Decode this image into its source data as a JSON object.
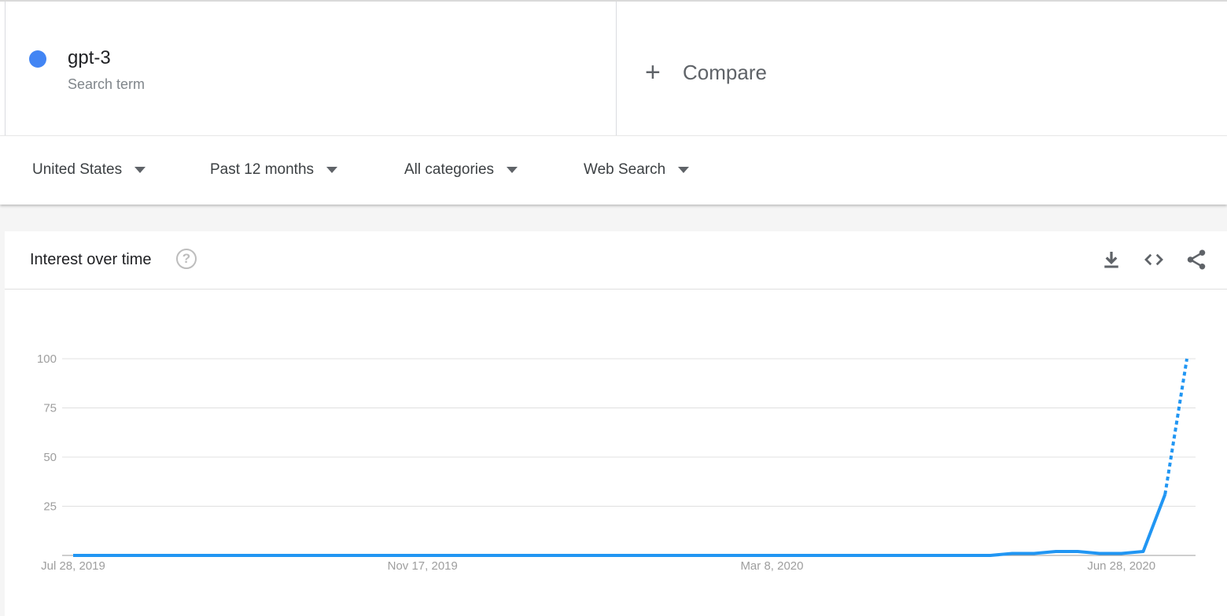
{
  "term": {
    "name": "gpt-3",
    "type": "Search term",
    "color": "#4285f4"
  },
  "compare": {
    "plus": "+",
    "label": "Compare"
  },
  "filters": [
    {
      "label": "United States"
    },
    {
      "label": "Past 12 months"
    },
    {
      "label": "All categories"
    },
    {
      "label": "Web Search"
    }
  ],
  "card": {
    "title": "Interest over time",
    "help_icon": "help-circle-icon",
    "icons": [
      "download-icon",
      "embed-code-icon",
      "share-icon"
    ]
  },
  "chart_data": {
    "type": "line",
    "title": "",
    "y_ticks": [
      100,
      75,
      50,
      25
    ],
    "x_tick_labels": [
      "Jul 28, 2019",
      "Nov 17, 2019",
      "Mar 8, 2020",
      "Jun 28, 2020"
    ],
    "ylim": [
      0,
      100
    ],
    "grid": true,
    "series": [
      {
        "color": "#2196f3",
        "x": [
          "2019-07-28",
          "2019-08-04",
          "2019-08-11",
          "2019-08-18",
          "2019-08-25",
          "2019-09-01",
          "2019-09-08",
          "2019-09-15",
          "2019-09-22",
          "2019-09-29",
          "2019-10-06",
          "2019-10-13",
          "2019-10-20",
          "2019-10-27",
          "2019-11-03",
          "2019-11-10",
          "2019-11-17",
          "2019-11-24",
          "2019-12-01",
          "2019-12-08",
          "2019-12-15",
          "2019-12-22",
          "2019-12-29",
          "2020-01-05",
          "2020-01-12",
          "2020-01-19",
          "2020-01-26",
          "2020-02-02",
          "2020-02-09",
          "2020-02-16",
          "2020-02-23",
          "2020-03-01",
          "2020-03-08",
          "2020-03-15",
          "2020-03-22",
          "2020-03-29",
          "2020-04-05",
          "2020-04-12",
          "2020-04-19",
          "2020-04-26",
          "2020-05-03",
          "2020-05-10",
          "2020-05-17",
          "2020-05-24",
          "2020-05-31",
          "2020-06-07",
          "2020-06-14",
          "2020-06-21",
          "2020-06-28",
          "2020-07-05",
          "2020-07-12",
          "2020-07-19"
        ],
        "values": [
          0,
          0,
          0,
          0,
          0,
          0,
          0,
          0,
          0,
          0,
          0,
          0,
          0,
          0,
          0,
          0,
          0,
          0,
          0,
          0,
          0,
          0,
          0,
          0,
          0,
          0,
          0,
          0,
          0,
          0,
          0,
          0,
          0,
          0,
          0,
          0,
          0,
          0,
          0,
          0,
          0,
          0,
          0,
          1,
          1,
          2,
          2,
          1,
          1,
          2,
          31,
          100
        ],
        "partial_from_index": 50
      }
    ]
  }
}
